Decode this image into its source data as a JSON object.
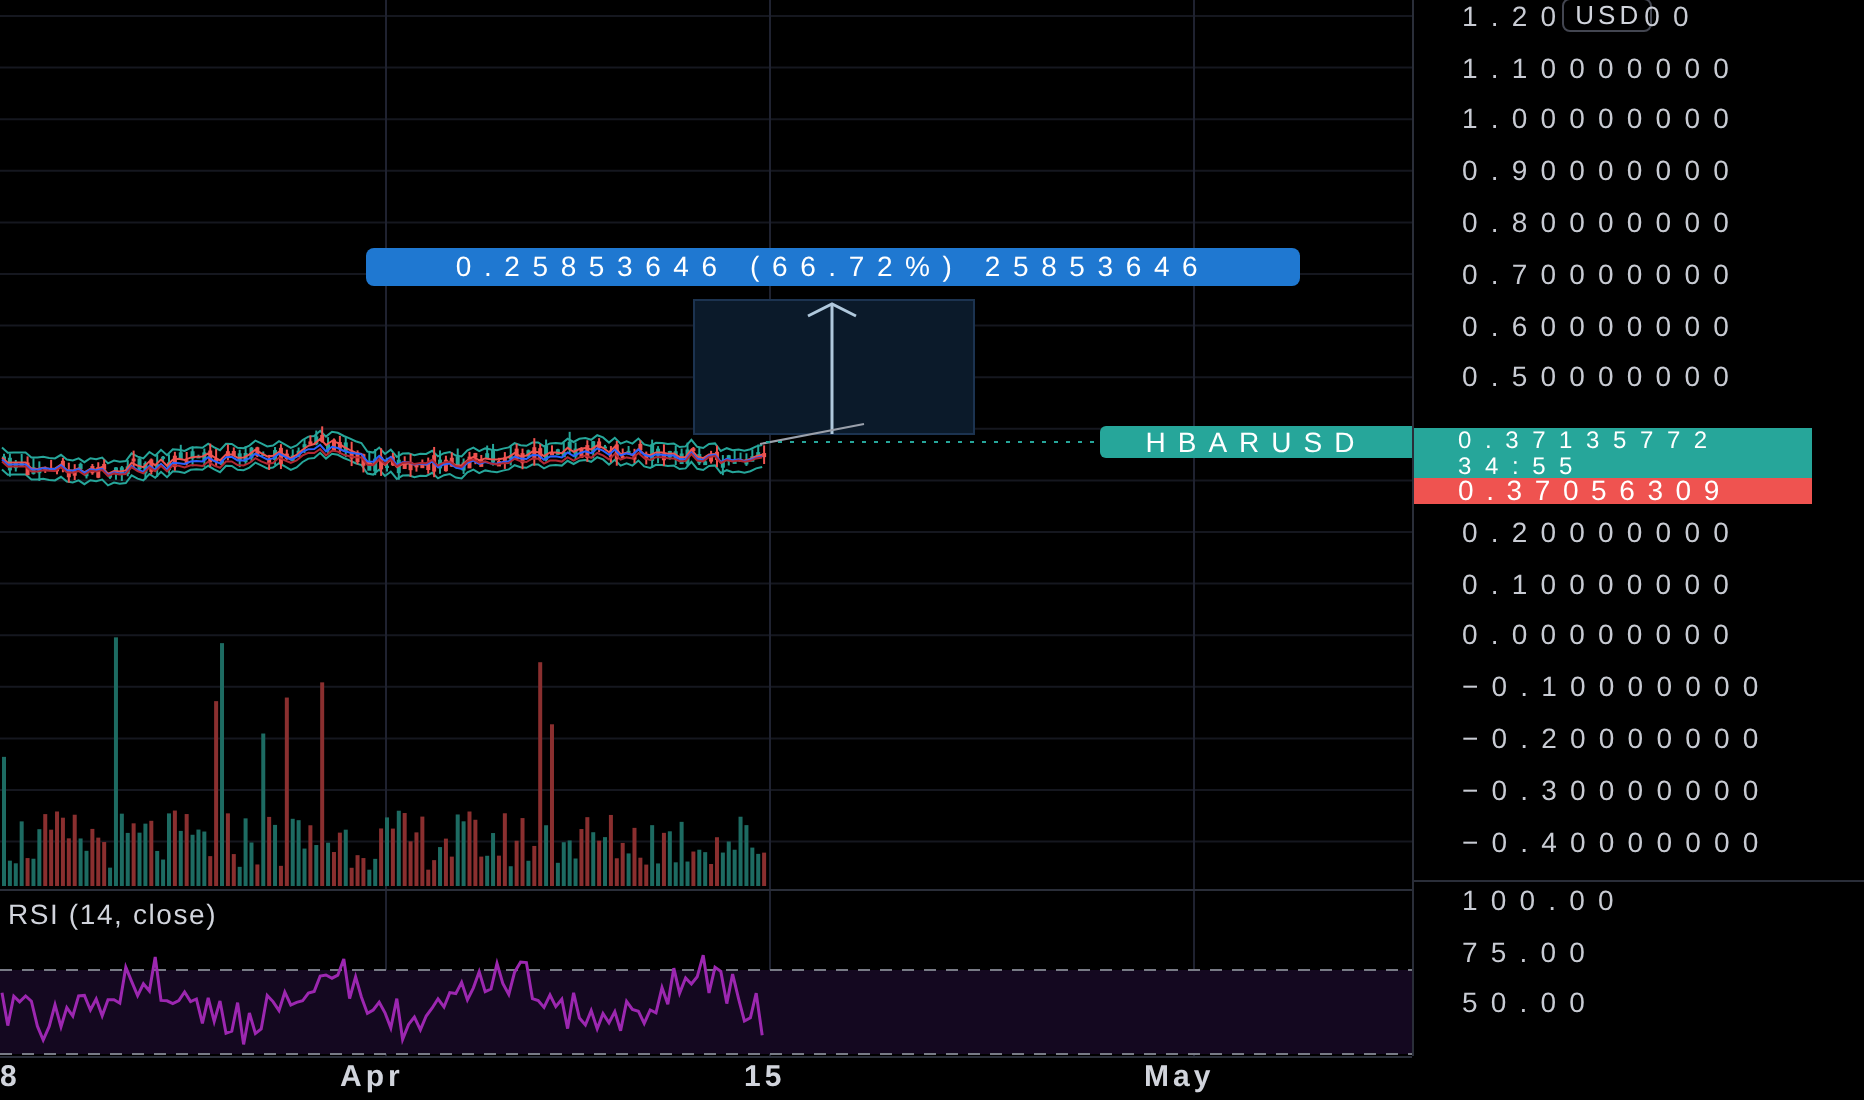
{
  "price_axis": {
    "top_tick_parts": [
      "1.20",
      "00"
    ],
    "currency": "USD",
    "ticks_upper": [
      "1.10000000",
      "1.00000000",
      "0.90000000",
      "0.80000000",
      "0.70000000",
      "0.60000000",
      "0.50000000"
    ],
    "last_price": {
      "value": "0.37135772",
      "countdown": "34:55"
    },
    "second_price": "0.37056309",
    "ticks_lower": [
      "0.20000000",
      "0.10000000",
      "0.00000000",
      "−0.10000000",
      "−0.20000000",
      "−0.30000000",
      "−0.40000000"
    ]
  },
  "symbol_label": "HBARUSD",
  "measure": {
    "label": "0.25853646 (66.72%) 25853646"
  },
  "rsi": {
    "title": "RSI (14, close)",
    "ticks": [
      "100.00",
      "75.00",
      "50.00"
    ]
  },
  "time_axis": [
    "8",
    "Apr",
    "15",
    "May"
  ]
}
